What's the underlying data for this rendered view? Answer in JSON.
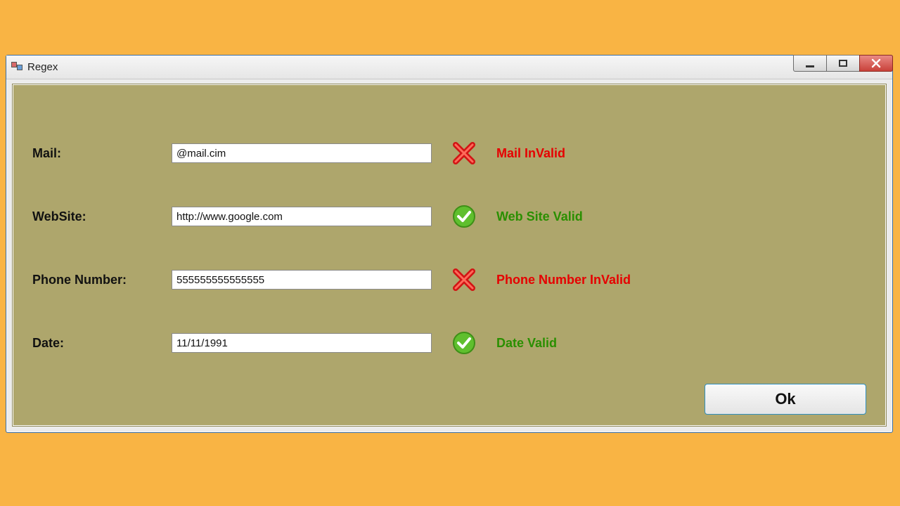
{
  "window": {
    "title": "Regex"
  },
  "labels": {
    "mail": "Mail:",
    "website": "WebSite:",
    "phone": "Phone Number:",
    "date": "Date:"
  },
  "inputs": {
    "mail": "@mail.cim",
    "website": "http://www.google.com",
    "phone": "555555555555555",
    "date": "11/11/1991"
  },
  "messages": {
    "mail": "Mail InValid",
    "website": "Web Site Valid",
    "phone": "Phone Number InValid",
    "date": "Date Valid"
  },
  "buttons": {
    "ok": "Ok"
  },
  "validity": {
    "mail": false,
    "website": true,
    "phone": false,
    "date": true
  },
  "colors": {
    "page_bg": "#f9b444",
    "client_bg": "#aea66c",
    "error_text": "#e60000",
    "valid_text": "#2a8f00"
  }
}
